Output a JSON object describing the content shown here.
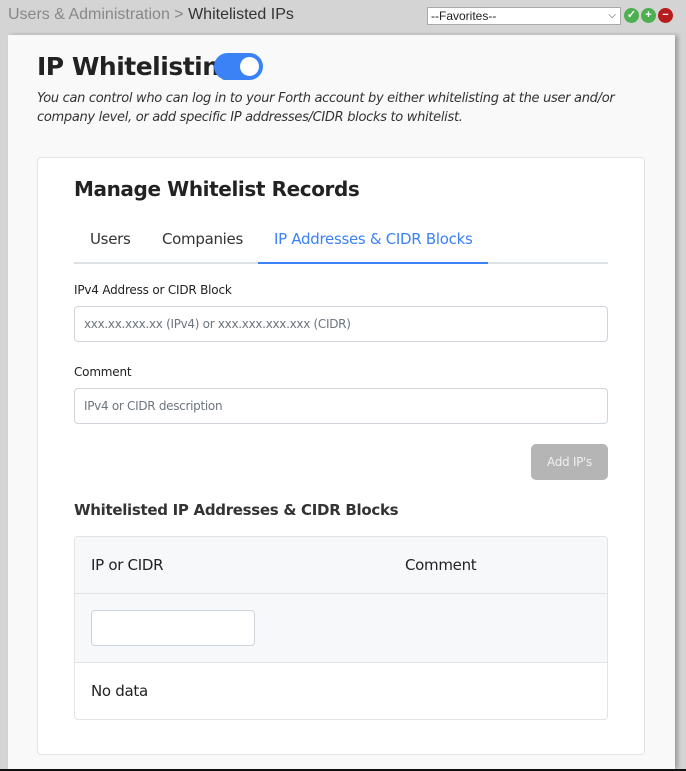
{
  "topbar": {
    "breadcrumb": {
      "parent": "Users & Administration",
      "separator": " > ",
      "current": "Whitelisted IPs"
    },
    "favorites": {
      "selected": "--Favorites--",
      "chevron_icon": "chevron-down-icon"
    },
    "actions": [
      {
        "name": "confirm-favorite",
        "icon": "check-circle-icon",
        "glyph": "✓",
        "color": "#4caf50"
      },
      {
        "name": "add-favorite",
        "icon": "plus-circle-icon",
        "glyph": "+",
        "color": "#4caf50"
      },
      {
        "name": "remove-favorite",
        "icon": "minus-circle-icon",
        "glyph": "−",
        "color": "#b71c1c"
      }
    ]
  },
  "page": {
    "title": "IP Whitelisting",
    "toggle_enabled": true,
    "accent_color": "#3b82f6",
    "description": "You can control who can log in to your Forth account by either whitelisting at the user and/or company level, or add specific IP addresses/CIDR blocks to whitelist."
  },
  "card": {
    "title": "Manage Whitelist Records",
    "tabs": [
      {
        "label": "Users",
        "active": false
      },
      {
        "label": "Companies",
        "active": false
      },
      {
        "label": "IP Addresses & CIDR Blocks",
        "active": true
      }
    ],
    "form": {
      "ip_label": "IPv4 Address or CIDR Block",
      "ip_value": "",
      "ip_placeholder": "xxx.xx.xxx.xx (IPv4) or xxx.xxx.xxx.xxx (CIDR)",
      "comment_label": "Comment",
      "comment_value": "",
      "comment_placeholder": "IPv4 or CIDR description",
      "submit_label": "Add IP's",
      "submit_disabled": true
    },
    "table": {
      "title": "Whitelisted IP Addresses & CIDR Blocks",
      "columns": [
        "IP or CIDR",
        "Comment"
      ],
      "filter_value": "",
      "rows": [],
      "empty_text": "No data"
    }
  }
}
